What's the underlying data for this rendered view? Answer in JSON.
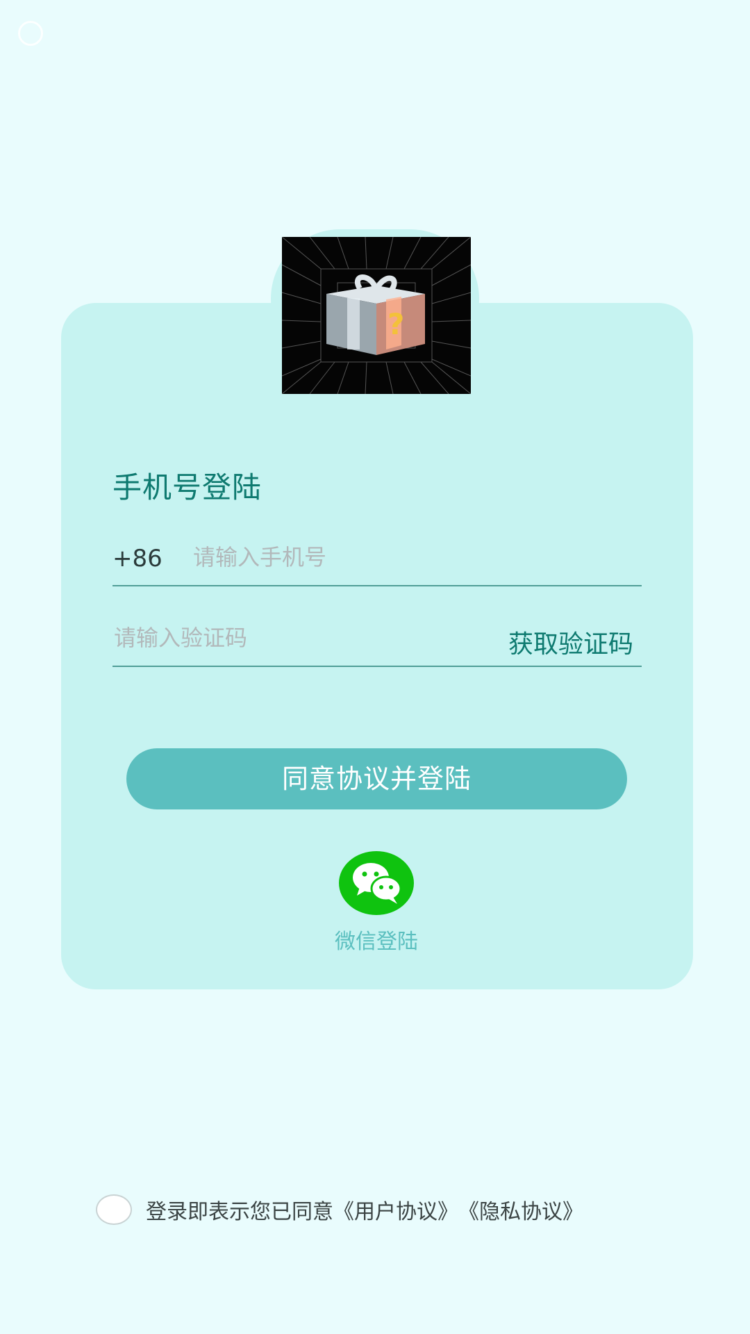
{
  "hero": {
    "image_icon": "mystery-gift-box-icon"
  },
  "login": {
    "title": "手机号登陆",
    "country_code": "+86",
    "phone_placeholder": "请输入手机号",
    "code_placeholder": "请输入验证码",
    "get_code_label": "获取验证码",
    "submit_label": "同意协议并登陆"
  },
  "wechat": {
    "icon": "wechat-icon",
    "label": "微信登陆"
  },
  "agreement": {
    "text": "登录即表示您已同意",
    "user_agreement": "《用户协议》",
    "privacy_agreement": "《隐私协议》"
  },
  "colors": {
    "background": "#e9fcfd",
    "card": "#c6f3f1",
    "accent_text": "#0e7a70",
    "button": "#5bbfbf",
    "wechat_green": "#0fc30f"
  }
}
